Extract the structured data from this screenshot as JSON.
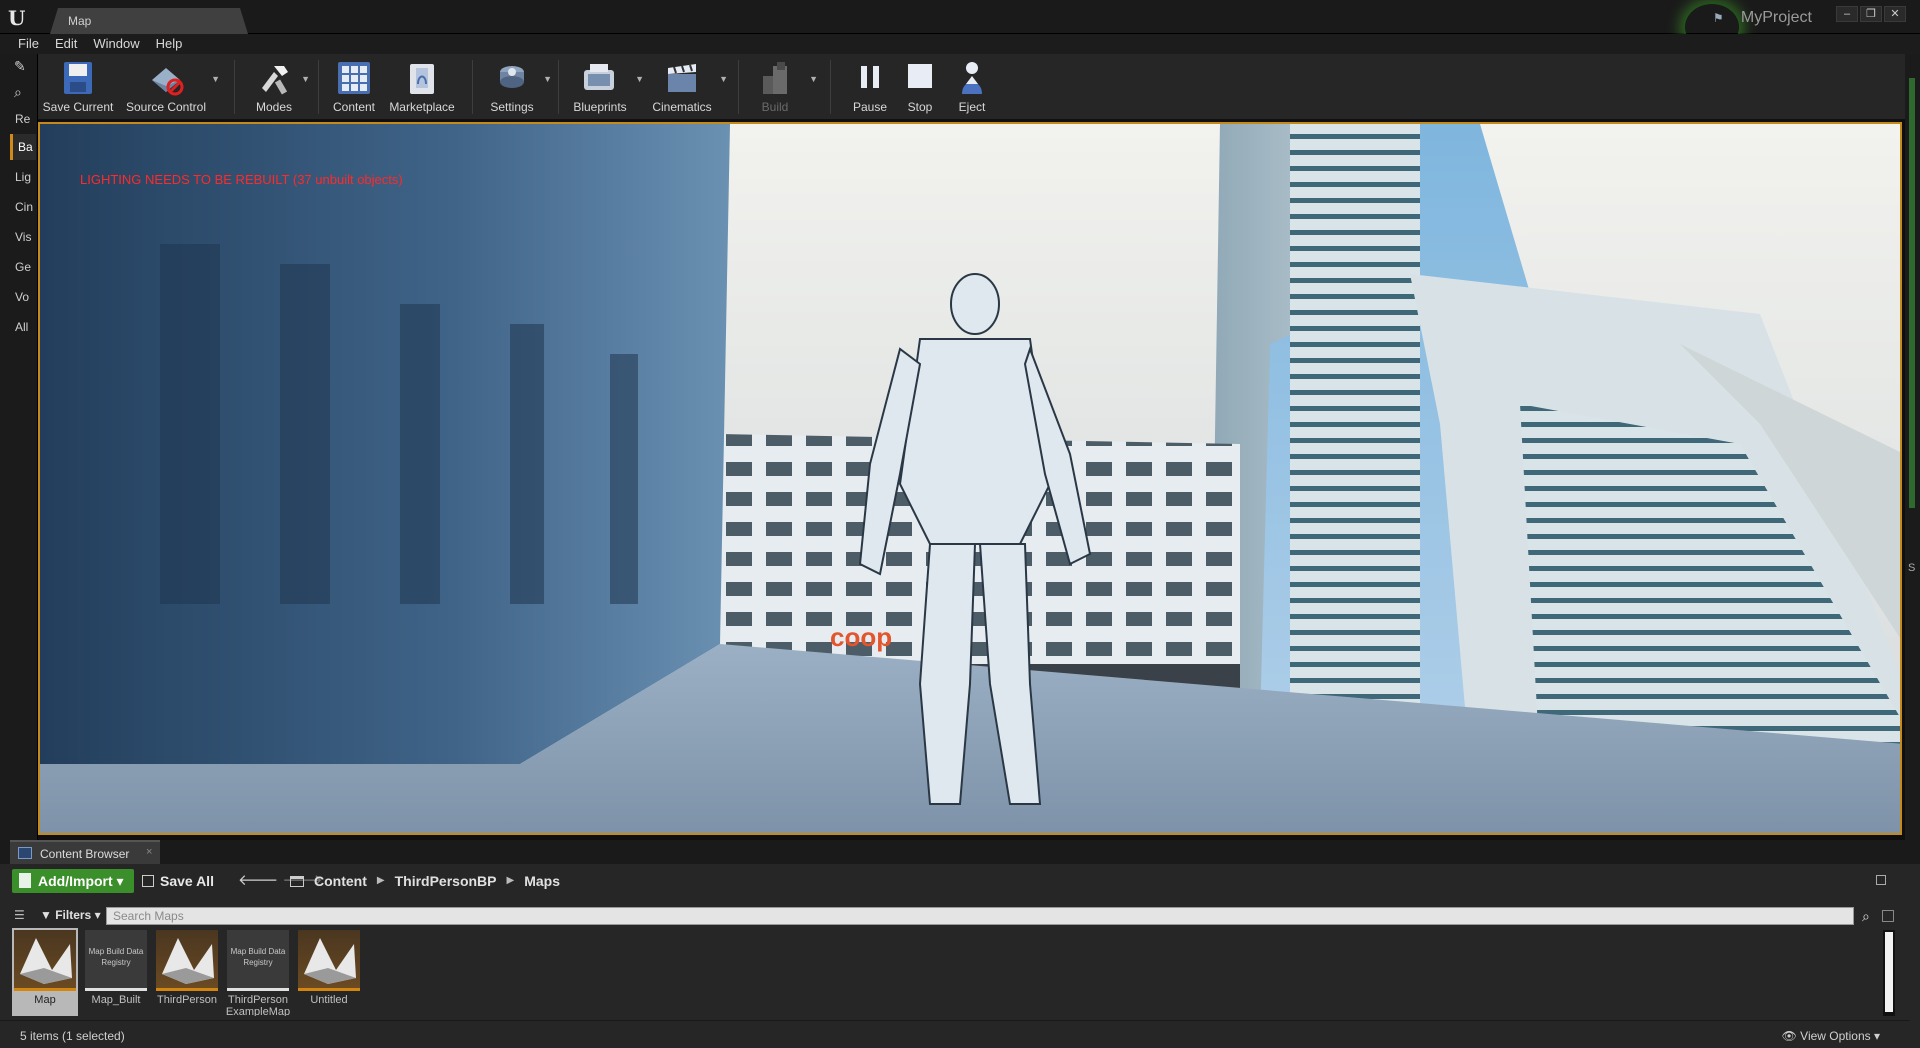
{
  "titlebar": {
    "tab_label": "Map",
    "project_name": "MyProject",
    "window_buttons": [
      "–",
      "❐",
      "✕"
    ]
  },
  "menu": [
    "File",
    "Edit",
    "Window",
    "Help"
  ],
  "left_panel": {
    "tabs": [
      "Re",
      "Ba",
      "Lig",
      "Cin",
      "Vis",
      "Ge",
      "Vo",
      "All"
    ],
    "selected": "Ba"
  },
  "toolbar": {
    "buttons": [
      {
        "label": "Save Current",
        "icon": "save-icon"
      },
      {
        "label": "Source Control",
        "icon": "source-control-icon"
      },
      {
        "label": "Modes",
        "icon": "modes-icon"
      },
      {
        "label": "Content",
        "icon": "content-grid-icon"
      },
      {
        "label": "Marketplace",
        "icon": "marketplace-icon"
      },
      {
        "label": "Settings",
        "icon": "settings-icon"
      },
      {
        "label": "Blueprints",
        "icon": "blueprints-icon"
      },
      {
        "label": "Cinematics",
        "icon": "cinematics-icon"
      },
      {
        "label": "Build",
        "icon": "build-icon"
      },
      {
        "label": "Pause",
        "icon": "pause-icon"
      },
      {
        "label": "Stop",
        "icon": "stop-icon"
      },
      {
        "label": "Eject",
        "icon": "eject-icon"
      }
    ]
  },
  "viewport": {
    "lighting_warning": "LIGHTING NEEDS TO BE REBUILT (37 unbuilt objects)",
    "shop_sign": "coop"
  },
  "right_panel": {
    "label": "S"
  },
  "content_browser": {
    "tab_label": "Content Browser",
    "add_import": "Add/Import",
    "save_all": "Save All",
    "breadcrumbs": [
      "Content",
      "ThirdPersonBP",
      "Maps"
    ],
    "filters": "Filters",
    "search_placeholder": "Search Maps",
    "assets": [
      {
        "name": "Map",
        "type": "map",
        "thumb_text": ""
      },
      {
        "name": "Map_Built",
        "type": "registry",
        "thumb_text": "Map Build Data Registry"
      },
      {
        "name": "ThirdPerson",
        "type": "map",
        "thumb_text": ""
      },
      {
        "name": "ThirdPerson ExampleMap",
        "type": "registry",
        "thumb_text": "Map Build Data Registry"
      },
      {
        "name": "Untitled",
        "type": "map",
        "thumb_text": ""
      }
    ],
    "selected_asset": "Map",
    "status": "5 items (1 selected)",
    "view_options": "View Options"
  },
  "colors": {
    "accent": "#d08a1a",
    "add_button": "#3b8f2a",
    "warning": "#ff2a2a",
    "panel": "#262626"
  }
}
